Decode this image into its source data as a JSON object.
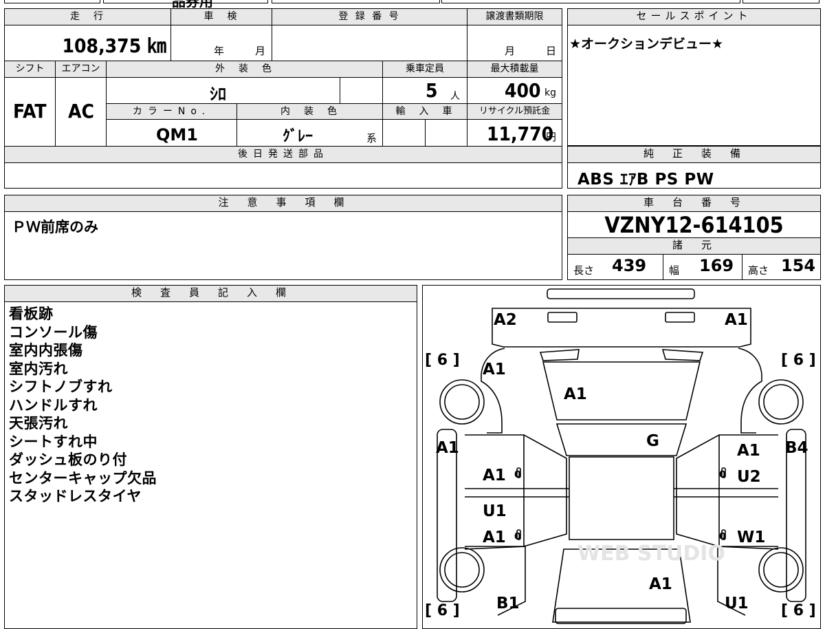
{
  "top_fragment": "品券用",
  "mileage": {
    "header": "走　行",
    "value": "108,375 ㎞"
  },
  "inspection": {
    "header": "車　検",
    "year_unit": "年",
    "month_unit": "月"
  },
  "registration": {
    "header": "登 録 番 号",
    "value": ""
  },
  "transfer_deadline": {
    "header": "譲渡書類期限",
    "month_unit": "月",
    "day_unit": "日"
  },
  "sales_point": {
    "header": "セールスポイント",
    "value": "★オークションデビュー★"
  },
  "shift": {
    "header": "シフト",
    "value": "FAT"
  },
  "aircon": {
    "header": "エアコン",
    "value": "AC"
  },
  "exterior_color": {
    "header": "外　装　色",
    "value": "ｼﾛ"
  },
  "capacity": {
    "header": "乗車定員",
    "value": "5",
    "unit": "人"
  },
  "max_load": {
    "header": "最大積載量",
    "value": "400",
    "unit": "kg"
  },
  "color_no": {
    "header": "カラーNo.",
    "value": "QM1"
  },
  "interior_color": {
    "header": "内　装　色",
    "value": "ｸﾞﾚｰ",
    "suffix": "系"
  },
  "import": {
    "header": "輸　入　車"
  },
  "recycle_fee": {
    "header": "リサイクル預託金",
    "value": "11,770",
    "unit": "円"
  },
  "later_parts": {
    "header": "後日発送部品",
    "value": ""
  },
  "genuine_equipment": {
    "header": "純　正　装　備",
    "value": "ABS ｴｱB PS PW"
  },
  "notes": {
    "header": "注　意　事　項　欄",
    "value": "ＰＷ前席のみ"
  },
  "chassis": {
    "header": "車　台　番　号",
    "value": "VZNY12-614105"
  },
  "specs": {
    "header": "諸　元",
    "length_label": "長さ",
    "length": "439",
    "width_label": "幅",
    "width": "169",
    "height_label": "高さ",
    "height": "154"
  },
  "inspector": {
    "header": "検　査　員　記　入　欄",
    "lines": [
      "看板跡",
      "コンソール傷",
      "室内内張傷",
      "室内汚れ",
      "シフトノブすれ",
      "ハンドルすれ",
      "天張汚れ",
      "シートすれ中",
      "ダッシュ板のり付",
      "センターキャップ欠品",
      "スタッドレスタイヤ"
    ]
  },
  "diagram": {
    "tire_left_top": "[ 6 ]",
    "tire_right_top": "[ 6 ]",
    "tire_left_bottom": "[ 6 ]",
    "tire_right_bottom": "[ 6 ]",
    "mark_a2": "A2",
    "mark_a1_rear_right": "A1",
    "mark_a1_left_rear_fender": "A1",
    "mark_a1_roof": "A1",
    "mark_g": "G",
    "mark_a1_left_side": "A1",
    "mark_a1_right_door_top": "A1",
    "mark_b4": "B4",
    "mark_a1_left_door_rear": "A1",
    "mark_u2": "U2",
    "mark_u1_left_door": "U1",
    "mark_a1_left_door_front": "A1",
    "mark_w1": "W1",
    "mark_a1_hood": "A1",
    "mark_b1": "B1",
    "mark_u1_right_front": "U1",
    "zero_1": "0",
    "zero_2": "0",
    "zero_3": "0",
    "zero_4": "0",
    "watermark": "WEB STUDIO"
  }
}
